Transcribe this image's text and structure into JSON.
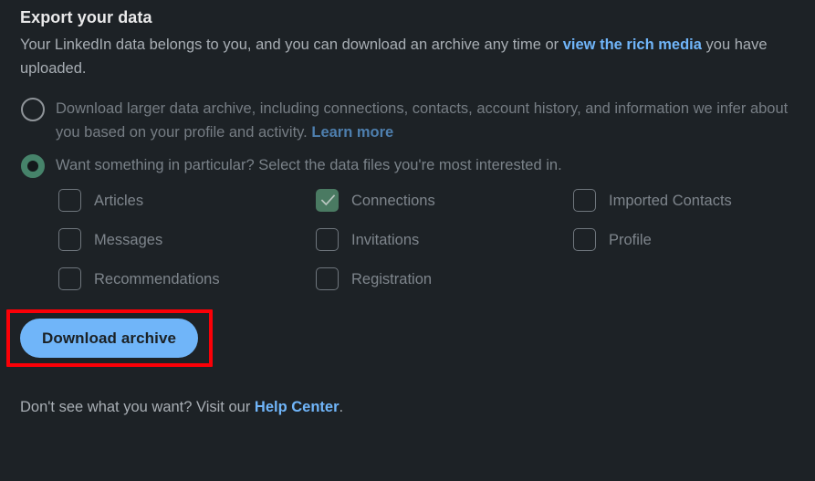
{
  "header": {
    "title": "Export your data",
    "intro_part1": "Your LinkedIn data belongs to you, and you can download an archive any time or ",
    "intro_link": "view the rich media",
    "intro_part2": " you have uploaded."
  },
  "options": [
    {
      "id": "larger-archive",
      "selected": false,
      "text_part1": "Download larger data archive, including connections, contacts, account history, and information we infer about you based on your profile and activity. ",
      "link": "Learn more"
    },
    {
      "id": "specific-files",
      "selected": true,
      "text_part1": "Want something in particular? Select the data files you're most interested in.",
      "link": ""
    }
  ],
  "checkboxes": [
    [
      {
        "label": "Articles",
        "checked": false
      },
      {
        "label": "Connections",
        "checked": true
      },
      {
        "label": "Imported Contacts",
        "checked": false
      }
    ],
    [
      {
        "label": "Messages",
        "checked": false
      },
      {
        "label": "Invitations",
        "checked": false
      },
      {
        "label": "Profile",
        "checked": false
      }
    ],
    [
      {
        "label": "Recommendations",
        "checked": false
      },
      {
        "label": "Registration",
        "checked": false
      },
      {
        "label": "",
        "checked": false
      }
    ]
  ],
  "action": {
    "download_label": "Download archive"
  },
  "footer": {
    "text_part1": "Don't see what you want? Visit our ",
    "link": "Help Center",
    "text_part2": "."
  },
  "colors": {
    "background": "#1d2226",
    "accent_blue": "#70b5f9",
    "accent_green": "#4a7a62",
    "radio_green": "#46836a",
    "annotation_red": "#fb0007",
    "text_primary": "#e9e9ea",
    "text_secondary": "#a8aeb4",
    "text_disabled": "#767d84"
  }
}
